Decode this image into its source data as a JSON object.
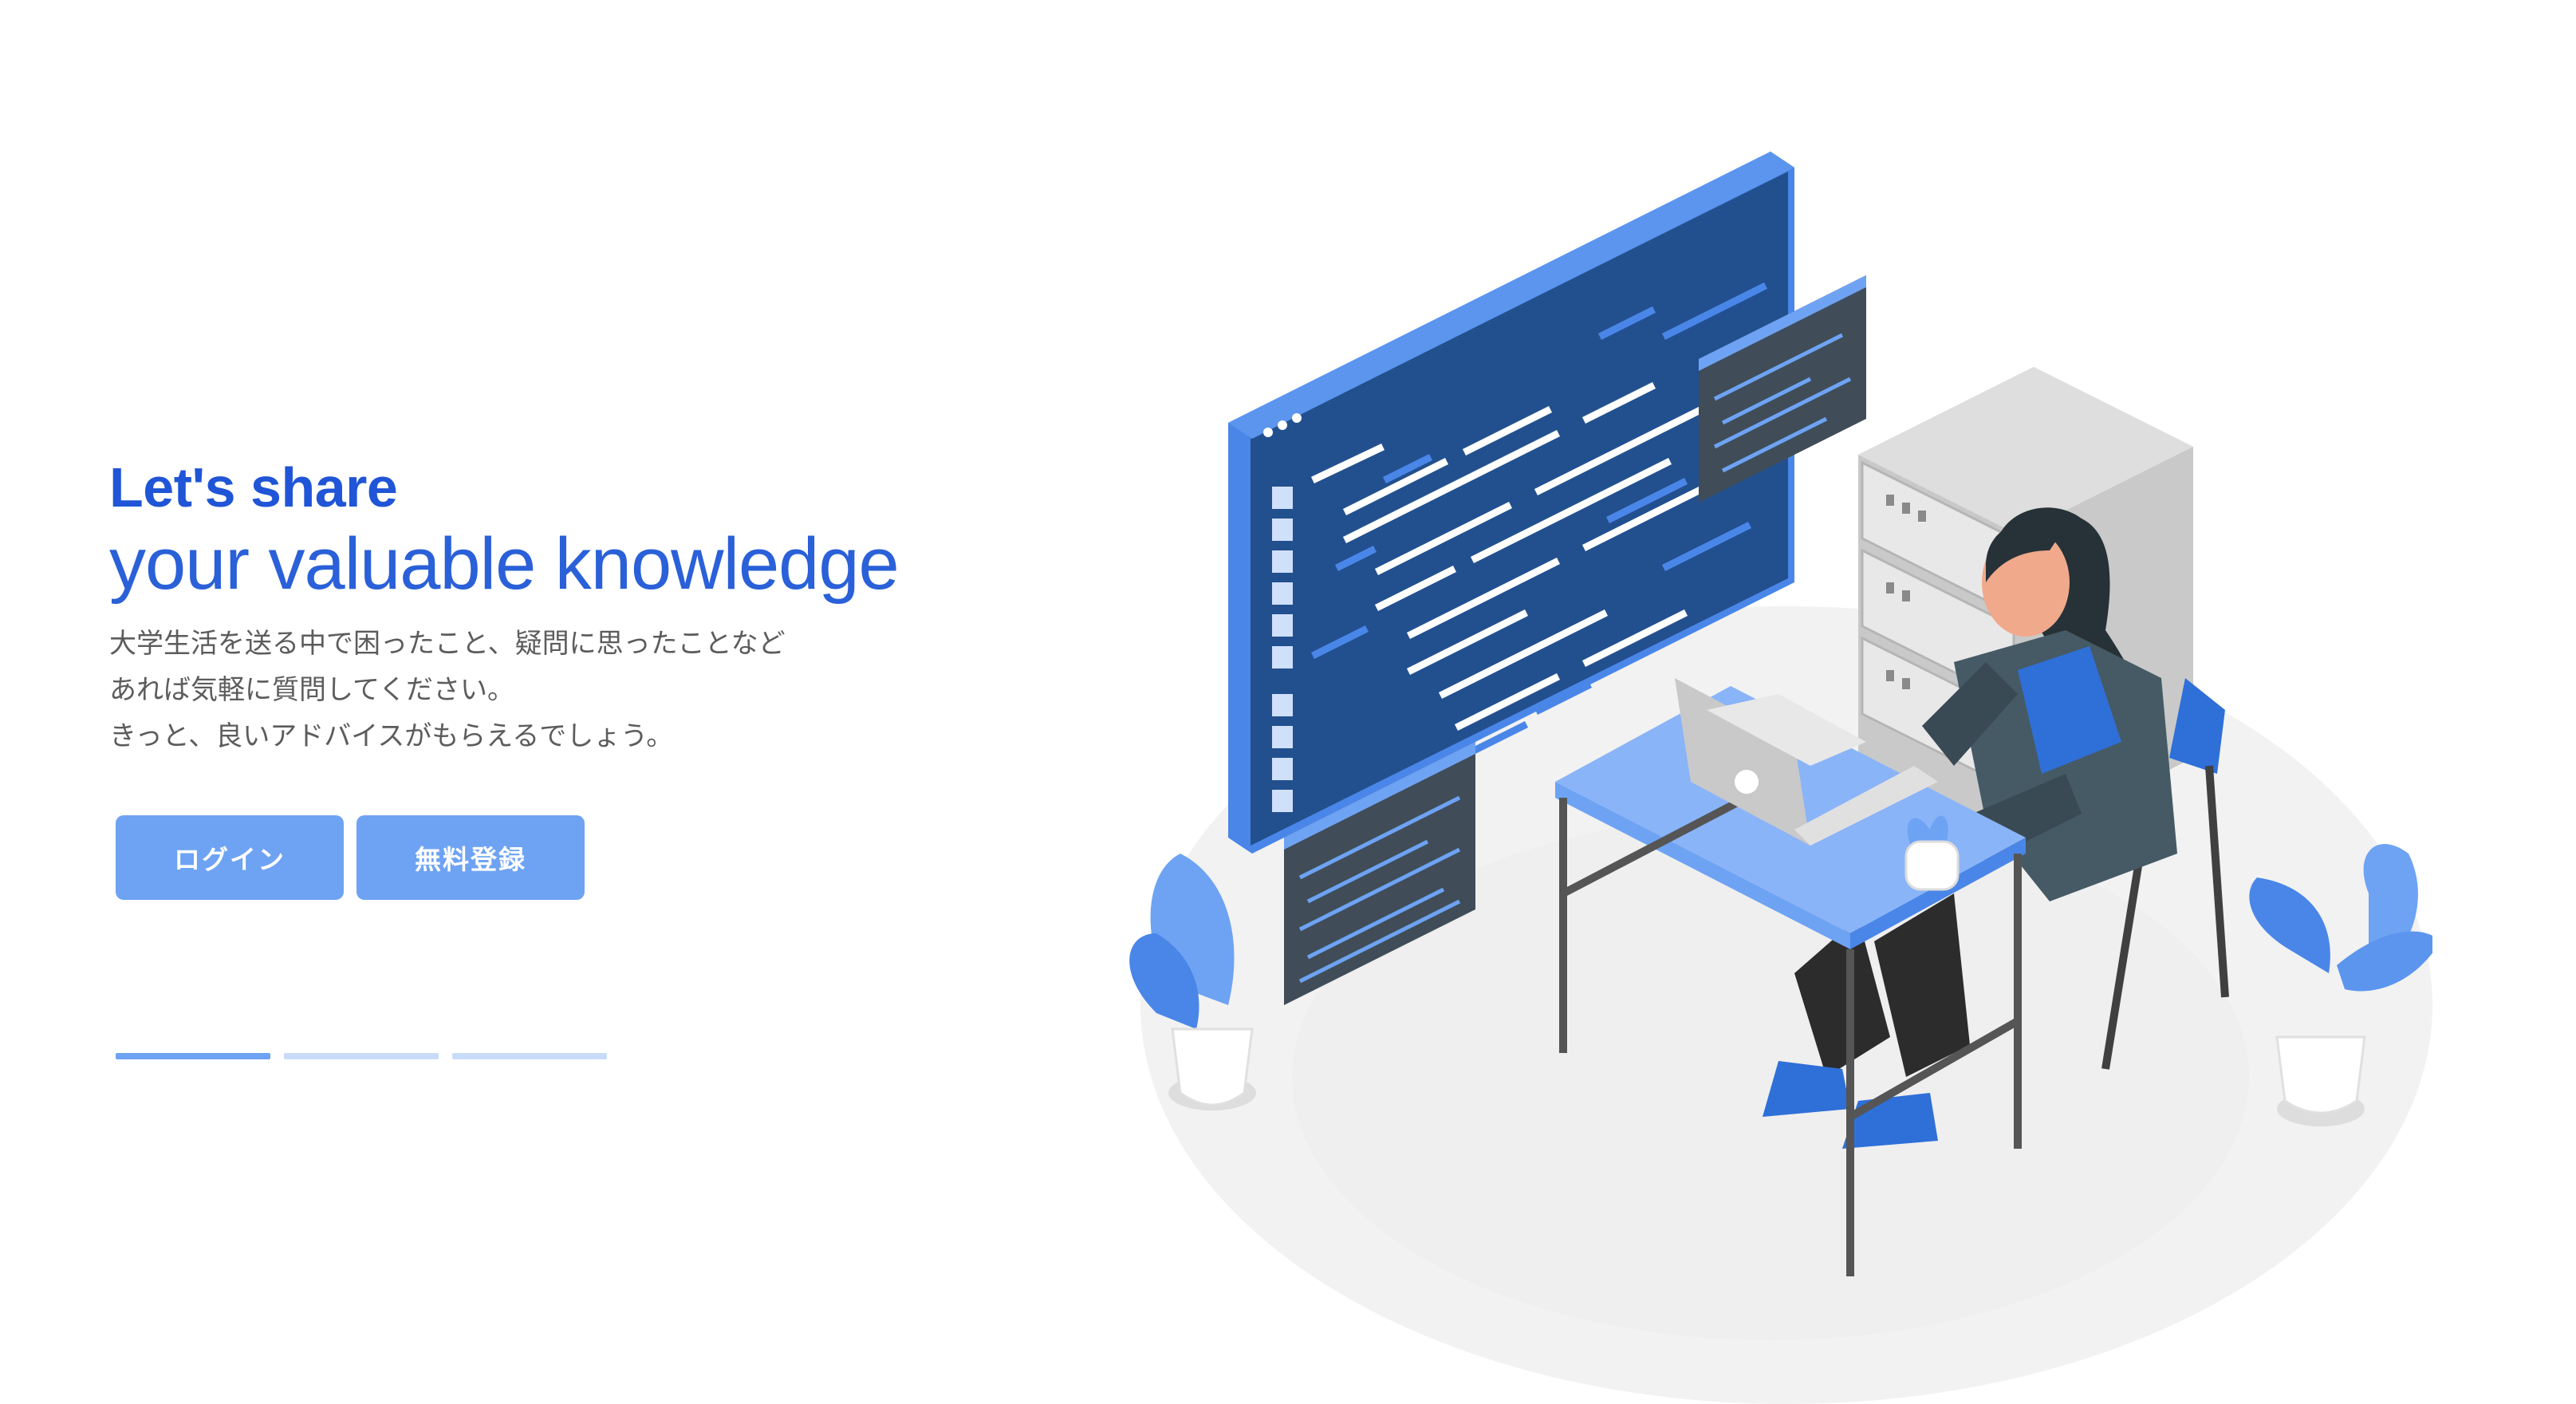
{
  "hero": {
    "headline_bold": "Let's share",
    "headline_light": "your valuable knowledge",
    "description_lines": [
      "大学生活を送る中で困ったこと、疑問に思ったことなど",
      "あれば気軽に質問してください。",
      "きっと、良いアドバイスがもらえるでしょう。"
    ]
  },
  "buttons": {
    "login_label": "ログイン",
    "register_label": "無料登録"
  },
  "carousel": {
    "slide_count": 3,
    "active_index": 0
  },
  "illustration": {
    "subject": "woman-working-at-laptop-with-code-screens-and-servers"
  },
  "colors": {
    "accent": "#1f55d6",
    "button": "#6ea3f3",
    "indicator_inactive": "#c8dcf9",
    "code_panel": "#22508f",
    "text_muted": "#5c5c5c"
  }
}
